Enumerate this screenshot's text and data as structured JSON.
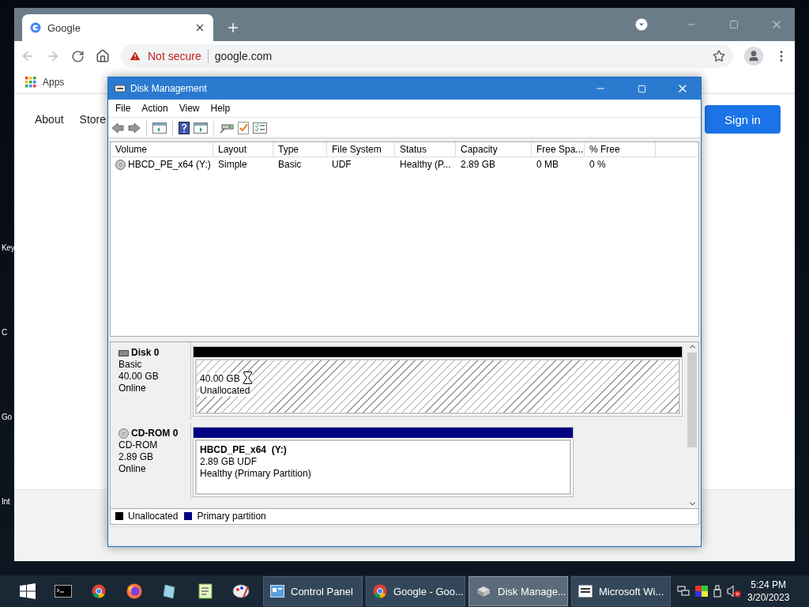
{
  "desktop": {
    "icon_labels": [
      "Key",
      "C",
      "Go",
      "Int"
    ]
  },
  "browser": {
    "tabs": [
      {
        "title": "Google",
        "selected": true
      }
    ],
    "security_label": "Not secure",
    "url": "google.com",
    "bookmarks": [
      {
        "label": "Apps"
      }
    ],
    "page": {
      "nav_links": [
        "About",
        "Store"
      ],
      "sign_in": "Sign in"
    }
  },
  "disk_management": {
    "title": "Disk Management",
    "menu": [
      "File",
      "Action",
      "View",
      "Help"
    ],
    "table": {
      "columns": [
        "Volume",
        "Layout",
        "Type",
        "File System",
        "Status",
        "Capacity",
        "Free Spa...",
        "% Free"
      ],
      "rows": [
        [
          "HBCD_PE_x64 (Y:)",
          "Simple",
          "Basic",
          "UDF",
          "Healthy (P...",
          "2.89 GB",
          "0 MB",
          "0 %"
        ]
      ]
    },
    "disks": [
      {
        "kind": "disk",
        "name": "Disk 0",
        "type": "Basic",
        "size": "40.00 GB",
        "status": "Online",
        "partitions": [
          {
            "kind": "unallocated",
            "size": "40.00 GB",
            "label": "Unallocated"
          }
        ]
      },
      {
        "kind": "cdrom",
        "name": "CD-ROM 0",
        "type": "CD-ROM",
        "size": "2.89 GB",
        "status": "Online",
        "partitions": [
          {
            "kind": "primary",
            "name": "HBCD_PE_x64  (Y:)",
            "size": "2.89 GB UDF",
            "label": "Healthy (Primary Partition)"
          }
        ]
      }
    ],
    "legend": [
      {
        "label": "Unallocated",
        "color": "#000000"
      },
      {
        "label": "Primary partition",
        "color": "#000080"
      }
    ]
  },
  "taskbar": {
    "windows": [
      {
        "kind": "panel",
        "label": "Control Panel",
        "selected": false
      },
      {
        "kind": "chrome",
        "label": "Google - Goo...",
        "selected": false
      },
      {
        "kind": "disk",
        "label": "Disk Manage...",
        "selected": true
      },
      {
        "kind": "list",
        "label": "Microsoft Wi...",
        "selected": false
      }
    ],
    "time": "5:24 PM",
    "date": "3/20/2023"
  }
}
